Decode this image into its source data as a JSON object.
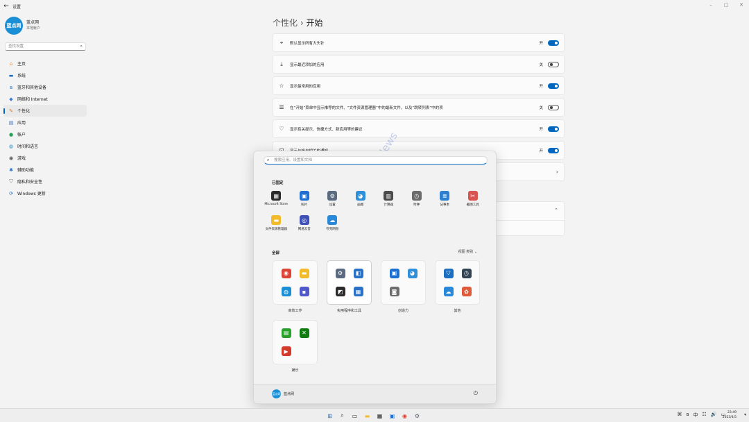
{
  "window": {
    "back": "←",
    "title": "设置",
    "controls": [
      "–",
      "▢",
      "✕"
    ]
  },
  "profile": {
    "avatar_text": "蓝点网",
    "name": "蓝点网",
    "type": "本地帐户"
  },
  "search": {
    "placeholder": "查找设置",
    "icon": "search-icon"
  },
  "nav": [
    {
      "label": "主页",
      "icon": "home-icon",
      "color": "#e08b3a",
      "glyph": "⌂"
    },
    {
      "label": "系统",
      "icon": "monitor-icon",
      "color": "#1a6fc0",
      "glyph": "▬"
    },
    {
      "label": "蓝牙和其他设备",
      "icon": "bluetooth-icon",
      "color": "#1a6fc0",
      "glyph": "ʙ"
    },
    {
      "label": "网络和 Internet",
      "icon": "wifi-icon",
      "color": "#3a7bd5",
      "glyph": "◆"
    },
    {
      "label": "个性化",
      "icon": "brush-icon",
      "color": "#d07a2a",
      "glyph": "✎",
      "active": true
    },
    {
      "label": "应用",
      "icon": "apps-icon",
      "color": "#3c6fbf",
      "glyph": "▤"
    },
    {
      "label": "帐户",
      "icon": "person-icon",
      "color": "#2aa05a",
      "glyph": "●"
    },
    {
      "label": "时间和语言",
      "icon": "globe-icon",
      "color": "#2a8fc0",
      "glyph": "◍"
    },
    {
      "label": "游戏",
      "icon": "gamepad-icon",
      "color": "#555555",
      "glyph": "◉"
    },
    {
      "label": "辅助功能",
      "icon": "accessibility-icon",
      "color": "#2a72c8",
      "glyph": "✱"
    },
    {
      "label": "隐私和安全性",
      "icon": "shield-icon",
      "color": "#777777",
      "glyph": "⛉"
    },
    {
      "label": "Windows 更新",
      "icon": "update-icon",
      "color": "#1a6fc0",
      "glyph": "⟳"
    }
  ],
  "heading": {
    "parent": "个性化",
    "separator": "›",
    "current": "开始"
  },
  "settings_rows": [
    {
      "label": "默认显示所有大头针",
      "icon": "pin-icon",
      "glyph": "⌖",
      "state": "开",
      "on": true
    },
    {
      "label": "显示最近添加的应用",
      "icon": "download-icon",
      "glyph": "⤓",
      "state": "关",
      "on": false
    },
    {
      "label": "显示最常用的应用",
      "icon": "star-icon",
      "glyph": "☆",
      "state": "开",
      "on": true
    },
    {
      "label": "在“开始”菜单中显示推荐的文件、“文件资源管理器”中的最新文件，以及“跳转列表”中的项",
      "icon": "list-icon",
      "glyph": "☰",
      "state": "关",
      "on": false
    },
    {
      "label": "显示有关提示、快捷方式、新应用等的建议",
      "icon": "bulb-icon",
      "glyph": "♡",
      "state": "开",
      "on": true
    },
    {
      "label": "显示与帐户相关的通知",
      "icon": "account-notify-icon",
      "glyph": "⊡",
      "state": "开",
      "on": true
    }
  ],
  "folders_row_chevron": "›",
  "extra_panel_chevron": "⌃",
  "start": {
    "search_placeholder": "搜索应用、设置和文档",
    "pinned_title": "已固定",
    "pinned": [
      {
        "label": "Microsoft Store",
        "icon": "store-icon",
        "color": "#2b2b2b",
        "glyph": "▦"
      },
      {
        "label": "照片",
        "icon": "photos-icon",
        "color": "#1f6fd1",
        "glyph": "▣"
      },
      {
        "label": "设置",
        "icon": "settings-gear-icon",
        "color": "#5a6a80",
        "glyph": "⚙"
      },
      {
        "label": "画图",
        "icon": "paint-icon",
        "color": "#2f8fd8",
        "glyph": "◕"
      },
      {
        "label": "计算器",
        "icon": "calculator-icon",
        "color": "#4a4a4a",
        "glyph": "▥"
      },
      {
        "label": "时钟",
        "icon": "clock-icon",
        "color": "#6b6b6b",
        "glyph": "◷"
      },
      {
        "label": "记事本",
        "icon": "notepad-icon",
        "color": "#2d7fcf",
        "glyph": "≣"
      },
      {
        "label": "截图工具",
        "icon": "snipping-icon",
        "color": "#d9534f",
        "glyph": "✂"
      },
      {
        "label": "文件资源管理器",
        "icon": "folder-icon",
        "color": "#f2bb2b",
        "glyph": "▬"
      },
      {
        "label": "网易云音",
        "icon": "music-icon",
        "color": "#3f51b5",
        "glyph": "◎"
      },
      {
        "label": "夸克网盘",
        "icon": "cloud-icon",
        "color": "#2a88d8",
        "glyph": "☁"
      }
    ],
    "all_title": "全部",
    "view_options": "视图 类别 ⌄",
    "groups": [
      {
        "label": "高效工作",
        "highlight": false,
        "icons": [
          {
            "name": "chrome-icon",
            "color": "#db4437",
            "glyph": "◉"
          },
          {
            "name": "folder-icon",
            "color": "#f2bb2b",
            "glyph": "▬"
          },
          {
            "name": "edge-icon",
            "color": "#1a8fd6",
            "glyph": "◍"
          },
          {
            "name": "teams-icon",
            "color": "#5059c9",
            "glyph": "▪"
          }
        ]
      },
      {
        "label": "实用程序和工具",
        "highlight": true,
        "icons": [
          {
            "name": "settings-gear-icon",
            "color": "#5a6a80",
            "glyph": "⚙"
          },
          {
            "name": "remote-help-icon",
            "color": "#2a72c8",
            "glyph": "◧"
          },
          {
            "name": "sticky-notes-icon",
            "color": "#2b2b2b",
            "glyph": "◩"
          },
          {
            "name": "windows-tools-icon",
            "color": "#2a72c8",
            "glyph": "▦"
          }
        ]
      },
      {
        "label": "创造力",
        "highlight": false,
        "icons": [
          {
            "name": "photos-icon",
            "color": "#1f6fd1",
            "glyph": "▣"
          },
          {
            "name": "paint-icon",
            "color": "#2f8fd8",
            "glyph": "◕"
          },
          {
            "name": "camera-icon",
            "color": "#6d6d6d",
            "glyph": "◙"
          }
        ]
      },
      {
        "label": "其他",
        "highlight": false,
        "icons": [
          {
            "name": "defender-icon",
            "color": "#1a6fc0",
            "glyph": "⛉"
          },
          {
            "name": "clock-icon",
            "color": "#334455",
            "glyph": "◷"
          },
          {
            "name": "cloud-icon",
            "color": "#2a88d8",
            "glyph": "☁"
          },
          {
            "name": "multi-app-icon",
            "color": "#e05a3a",
            "glyph": "✿"
          }
        ]
      },
      {
        "label": "娱乐",
        "highlight": false,
        "icons": [
          {
            "name": "media-icon",
            "color": "#2ca02c",
            "glyph": "▤"
          },
          {
            "name": "xbox-icon",
            "color": "#107c10",
            "glyph": "✕"
          },
          {
            "name": "media-player-icon",
            "color": "#d23a2a",
            "glyph": "▶"
          }
        ]
      }
    ],
    "user_name": "蓝点网",
    "user_avatar": "蓝点网",
    "power_glyph": "⏻"
  },
  "watermark": "@蓝点网 Landian.News",
  "taskbar": {
    "icons": [
      {
        "name": "start-icon",
        "color": "#1a6fd6",
        "glyph": "⊞"
      },
      {
        "name": "search-icon",
        "color": "#222222",
        "glyph": "⌕"
      },
      {
        "name": "taskview-icon",
        "color": "#333333",
        "glyph": "▭"
      },
      {
        "name": "folder-icon",
        "color": "#f2bb2b",
        "glyph": "▬"
      },
      {
        "name": "store-icon",
        "color": "#2b2b2b",
        "glyph": "▦"
      },
      {
        "name": "photos-icon",
        "color": "#1f6fd1",
        "glyph": "▣"
      },
      {
        "name": "chrome-icon",
        "color": "#db4437",
        "glyph": "◉"
      },
      {
        "name": "settings-gear-icon",
        "color": "#5a6a80",
        "glyph": "⚙"
      }
    ],
    "tray": [
      "⌘",
      "ʙ",
      "中",
      "☷",
      "🔊",
      "▭"
    ],
    "time": "23:49",
    "date": "2023/4/5"
  }
}
